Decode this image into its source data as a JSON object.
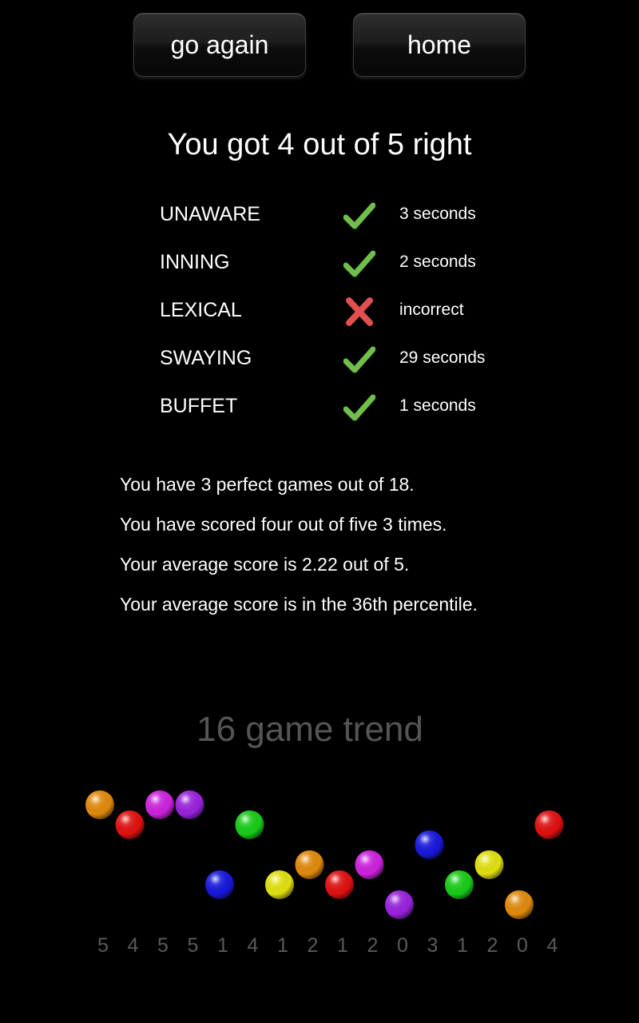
{
  "buttons": {
    "go_again": "go again",
    "home": "home"
  },
  "score_title": "You got 4 out of 5 right",
  "results": [
    {
      "word": "UNAWARE",
      "status": "correct",
      "time": "3 seconds"
    },
    {
      "word": "INNING",
      "status": "correct",
      "time": "2 seconds"
    },
    {
      "word": "LEXICAL",
      "status": "incorrect",
      "time": "incorrect"
    },
    {
      "word": "SWAYING",
      "status": "correct",
      "time": "29 seconds"
    },
    {
      "word": "BUFFET",
      "status": "correct",
      "time": "1 seconds"
    }
  ],
  "stats": [
    "You have 3 perfect games out of 18.",
    "You have scored four out of five 3 times.",
    "Your average score is 2.22 out of 5.",
    "Your average score is in the 36th percentile."
  ],
  "trend": {
    "title": "16 game trend",
    "scores": [
      5,
      4,
      5,
      5,
      1,
      4,
      1,
      2,
      1,
      2,
      0,
      3,
      1,
      2,
      0,
      4
    ],
    "colors": [
      "#e08a0a",
      "#e01010",
      "#cc22dd",
      "#9922dd",
      "#1818dd",
      "#18cc18",
      "#e0e010",
      "#e08a0a",
      "#e01010",
      "#cc22dd",
      "#9922dd",
      "#1818dd",
      "#18cc18",
      "#e0e010",
      "#e08a0a",
      "#e01010"
    ]
  },
  "icons": {
    "correct": "check-icon",
    "incorrect": "cross-icon"
  },
  "status_colors": {
    "correct": "#6fbf4a",
    "incorrect": "#e05050"
  }
}
